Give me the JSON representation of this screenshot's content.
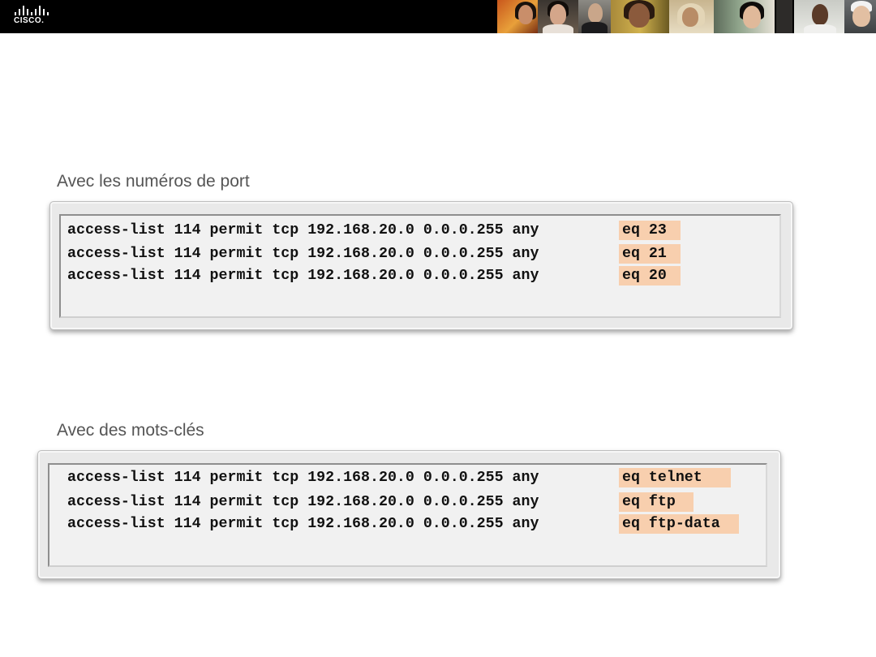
{
  "header": {
    "logo_text": "CISCO."
  },
  "sections": [
    {
      "title": "Avec les numéros de port",
      "lines": [
        {
          "prefix": "access-list 114 permit tcp 192.168.20.0 0.0.0.255 any",
          "highlight": "eq 23"
        },
        {
          "prefix": "access-list 114 permit tcp 192.168.20.0 0.0.0.255 any",
          "highlight": "eq 21"
        },
        {
          "prefix": "access-list 114 permit tcp 192.168.20.0 0.0.0.255 any",
          "highlight": "eq 20"
        }
      ]
    },
    {
      "title": "Avec des mots-clés",
      "lines": [
        {
          "prefix": "access-list 114 permit tcp 192.168.20.0 0.0.0.255 any",
          "highlight": "eq telnet"
        },
        {
          "prefix": "access-list 114 permit tcp 192.168.20.0 0.0.0.255 any",
          "highlight": "eq ftp"
        },
        {
          "prefix": "access-list 114 permit tcp 192.168.20.0 0.0.0.255 any",
          "highlight": "eq ftp-data"
        }
      ]
    }
  ],
  "colors": {
    "header_bg": "#000000",
    "highlight": "#f8cfae",
    "panel_bg": "#f1f1f1"
  }
}
